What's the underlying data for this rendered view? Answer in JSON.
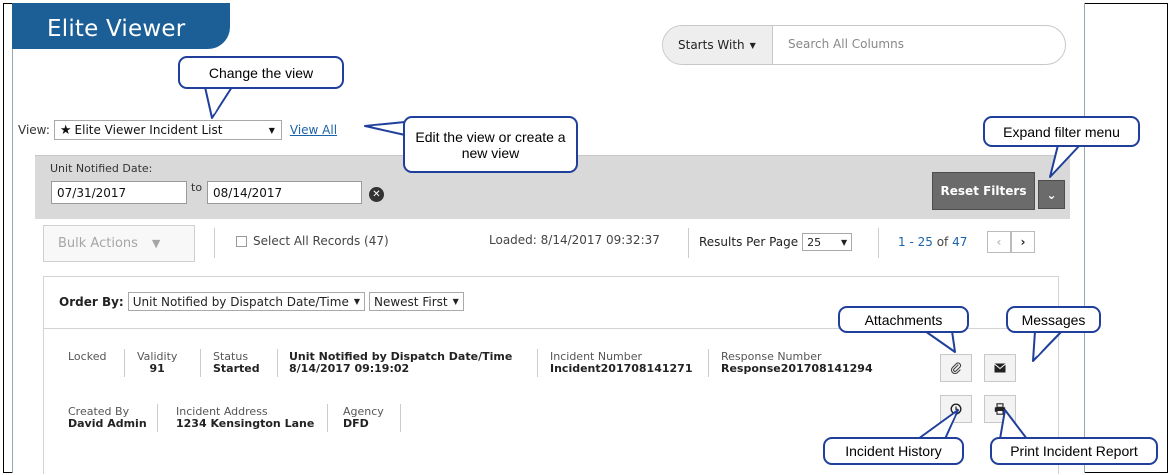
{
  "app": {
    "title": "Elite Viewer"
  },
  "search": {
    "mode": "Starts With",
    "placeholder": "Search All Columns"
  },
  "view": {
    "label": "View:",
    "selected": "Elite Viewer Incident List",
    "view_all": "View All"
  },
  "filters": {
    "label": "Unit Notified Date:",
    "from": "07/31/2017",
    "to_label": "to",
    "to": "08/14/2017",
    "reset": "Reset Filters"
  },
  "toolbar": {
    "bulk_actions": "Bulk Actions",
    "select_all": "Select All Records (47)",
    "loaded": "Loaded: 8/14/2017 09:32:37",
    "results_per_page_label": "Results Per Page",
    "results_per_page": "25",
    "range": "1 - 25",
    "range_of": "of",
    "total": "47"
  },
  "order": {
    "label": "Order By:",
    "field": "Unit Notified by Dispatch Date/Time",
    "direction": "Newest First"
  },
  "record": {
    "locked": {
      "label": "Locked"
    },
    "validity": {
      "label": "Validity",
      "value": "91"
    },
    "status": {
      "label": "Status",
      "value": "Started"
    },
    "unit_notified": {
      "label": "Unit Notified by Dispatch Date/Time",
      "value": "8/14/2017 09:19:02"
    },
    "incident_number": {
      "label": "Incident Number",
      "value": "Incident201708141271"
    },
    "response_number": {
      "label": "Response Number",
      "value": "Response201708141294"
    },
    "created_by": {
      "label": "Created By",
      "value": "David Admin"
    },
    "incident_address": {
      "label": "Incident Address",
      "value": "1234 Kensington Lane"
    },
    "agency": {
      "label": "Agency",
      "value": "DFD"
    }
  },
  "callouts": {
    "change_view": "Change the view",
    "edit_view": "Edit the view or create a new view",
    "expand_filter": "Expand filter menu",
    "attachments": "Attachments",
    "messages": "Messages",
    "incident_history": "Incident History",
    "print_report": "Print Incident Report"
  },
  "icons": [
    "paperclip-icon",
    "envelope-icon",
    "clock-icon",
    "printer-icon",
    "star-icon",
    "chevron-down-icon",
    "clear-icon"
  ],
  "colors": {
    "brand": "#1c5f97",
    "callout_border": "#1f3f9a",
    "link": "#1a63a8",
    "filter_band": "#d9d9d9",
    "button_dark": "#6b6b6b"
  }
}
